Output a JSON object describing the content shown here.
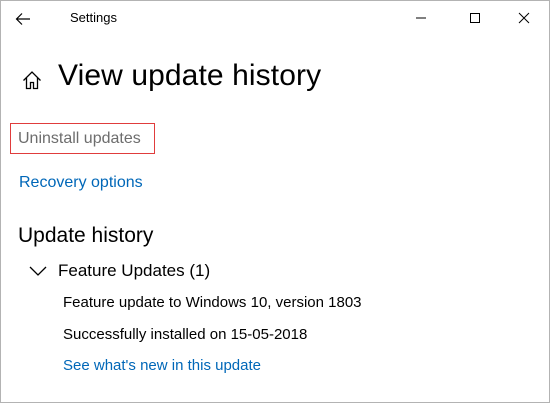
{
  "window": {
    "title": "Settings"
  },
  "header": {
    "title": "View update history"
  },
  "links": {
    "uninstall": "Uninstall updates",
    "recovery": "Recovery options"
  },
  "history": {
    "section_title": "Update history",
    "groups": [
      {
        "label": "Feature Updates (1)",
        "expanded": true,
        "items": [
          {
            "name": "Feature update to Windows 10, version 1803",
            "status": "Successfully installed on 15-05-2018",
            "link": "See what's new in this update"
          }
        ]
      }
    ]
  },
  "icons": {
    "back": "back-arrow-icon",
    "minimize": "minimize-icon",
    "maximize": "maximize-icon",
    "close": "close-icon",
    "home": "home-icon",
    "chevron": "chevron-down-icon"
  },
  "colors": {
    "link": "#0067b8",
    "disabled_text": "#6d6d6d",
    "highlight_box": "#e03c3c"
  }
}
